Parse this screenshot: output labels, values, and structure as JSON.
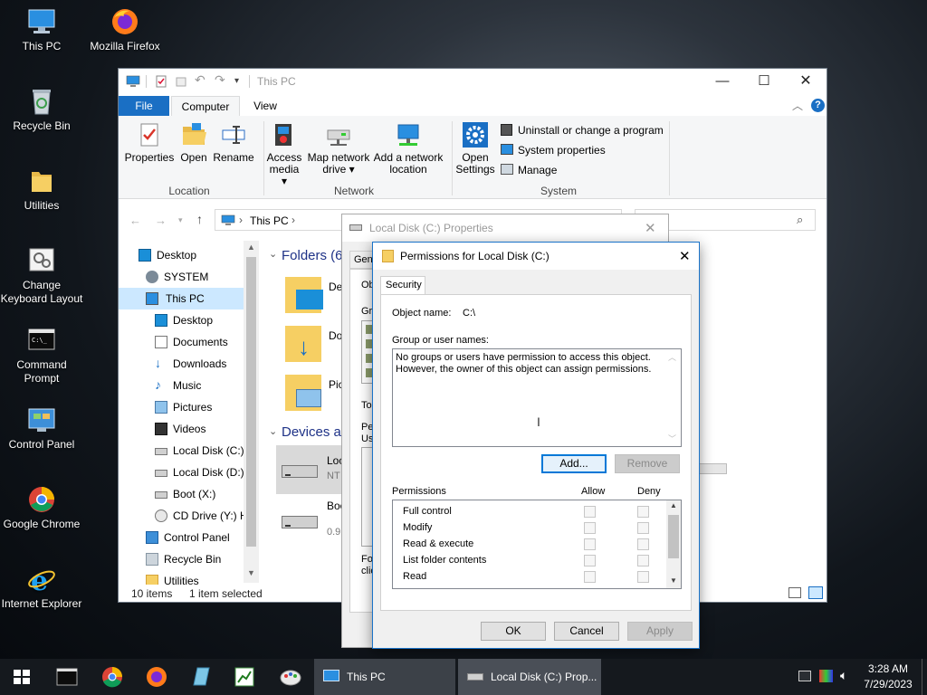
{
  "desktop": {
    "icons": [
      {
        "label": "This PC",
        "icon": "this-pc-icon"
      },
      {
        "label": "Mozilla Firefox",
        "icon": "firefox-icon"
      },
      {
        "label": "Recycle Bin",
        "icon": "recycle-bin-icon"
      },
      {
        "label": "Utilities",
        "icon": "folder-icon"
      },
      {
        "label": "Change Keyboard Layout",
        "icon": "keyboard-settings-icon"
      },
      {
        "label": "Command Prompt",
        "icon": "command-prompt-icon"
      },
      {
        "label": "Control Panel",
        "icon": "control-panel-icon"
      },
      {
        "label": "Google Chrome",
        "icon": "chrome-icon"
      },
      {
        "label": "Internet Explorer",
        "icon": "internet-explorer-icon"
      }
    ]
  },
  "explorer": {
    "title": "This PC",
    "tabs": [
      "File",
      "Computer",
      "View"
    ],
    "ribbon": {
      "location": {
        "buttons": [
          "Properties",
          "Open",
          "Rename"
        ],
        "group": "Location"
      },
      "network": {
        "access_media": [
          "Access",
          "media ▾"
        ],
        "map_drive": [
          "Map network",
          "drive ▾"
        ],
        "add_location": [
          "Add a network",
          "location"
        ],
        "group": "Network"
      },
      "system": {
        "open_settings": [
          "Open",
          "Settings"
        ],
        "links": [
          "Uninstall or change a program",
          "System properties",
          "Manage"
        ],
        "group": "System"
      }
    },
    "address": {
      "path": "This PC",
      "separator": "›"
    },
    "nav": [
      "Desktop",
      "SYSTEM",
      "This PC",
      "Desktop",
      "Documents",
      "Downloads",
      "Music",
      "Pictures",
      "Videos",
      "Local Disk (C:)",
      "Local Disk (D:)",
      "Boot (X:)",
      "CD Drive (Y:) H",
      "Control Panel",
      "Recycle Bin",
      "Utilities"
    ],
    "content": {
      "folders_header": "Folders (6",
      "folders": [
        "Des",
        "Dow",
        "Pict"
      ],
      "devices_header": "Devices ar",
      "devices": [
        {
          "name": "Loca",
          "detail": "NT"
        },
        {
          "name": "Boo",
          "detail": "0.9"
        }
      ]
    },
    "status": {
      "items": "10 items",
      "selected": "1 item selected"
    }
  },
  "properties_dialog": {
    "title": "Local Disk (C:) Properties",
    "tab_partial": "Gen",
    "labels": [
      "Ob",
      "Gr",
      "To",
      "Pe",
      "Us",
      "Fo",
      "clic"
    ]
  },
  "permissions_dialog": {
    "title": "Permissions for Local Disk (C:)",
    "tab": "Security",
    "object_label": "Object name:",
    "object_value": "C:\\",
    "group_label": "Group or user names:",
    "group_message_1": "No groups or users have permission to access this object.",
    "group_message_2": "However, the owner of this object can assign permissions.",
    "add_button": "Add...",
    "remove_button": "Remove",
    "permissions_label": "Permissions",
    "allow_label": "Allow",
    "deny_label": "Deny",
    "permissions": [
      "Full control",
      "Modify",
      "Read & execute",
      "List folder contents",
      "Read"
    ],
    "ok": "OK",
    "cancel": "Cancel",
    "apply": "Apply"
  },
  "taskbar": {
    "buttons": [
      {
        "label": "This PC"
      },
      {
        "label": "Local Disk (C:) Prop..."
      }
    ],
    "time": "3:28 AM",
    "date": "7/29/2023"
  }
}
